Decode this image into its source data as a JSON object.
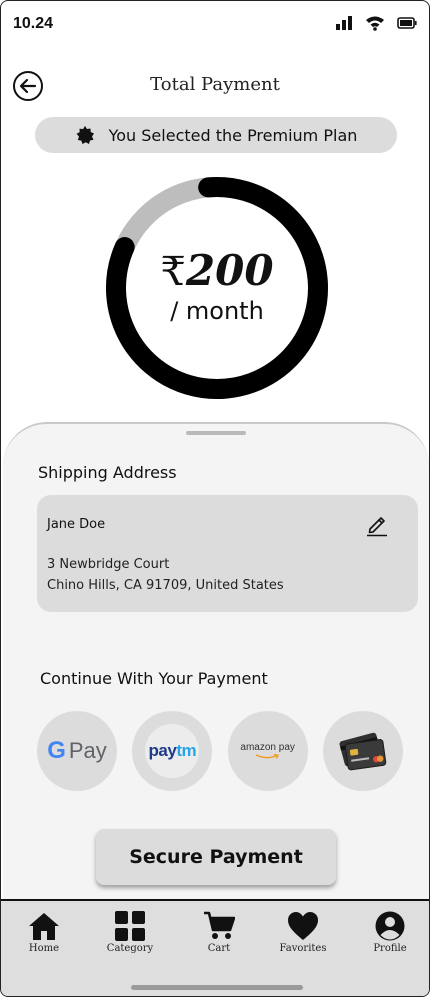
{
  "status_bar": {
    "time": "10.24",
    "icons": [
      "signal-icon",
      "wifi-icon",
      "battery-icon"
    ]
  },
  "header": {
    "title": "Total Payment",
    "back_icon": "arrow-left-icon"
  },
  "plan_banner": {
    "text": "You Selected the Premium Plan",
    "icon": "badge-icon"
  },
  "price": {
    "currency": "₹",
    "amount": "200",
    "period": "/ month",
    "ring_filled_fraction": 0.83
  },
  "shipping": {
    "label": "Shipping Address",
    "name": "Jane Doe",
    "address_line1": "3 Newbridge Court",
    "address_line2": "Chino Hills, CA 91709, United States",
    "edit_icon": "pencil-icon"
  },
  "payment": {
    "label": "Continue With Your Payment",
    "options": [
      {
        "name": "Google Pay",
        "text_g": "G",
        "text_pay": "Pay"
      },
      {
        "name": "Paytm",
        "text_pay": "pay",
        "text_tm": "tm"
      },
      {
        "name": "Amazon Pay",
        "text": "amazon pay"
      },
      {
        "name": "Card",
        "icon": "credit-card-icon"
      }
    ]
  },
  "cta": {
    "label": "Secure Payment"
  },
  "nav": {
    "items": [
      {
        "label": "Home",
        "icon": "home-icon"
      },
      {
        "label": "Category",
        "icon": "grid-icon"
      },
      {
        "label": "Cart",
        "icon": "cart-icon"
      },
      {
        "label": "Favorites",
        "icon": "heart-icon"
      },
      {
        "label": "Profile",
        "icon": "profile-icon"
      }
    ]
  },
  "colors": {
    "ring_filled": "#000000",
    "ring_track": "#bdbdbd",
    "sheet_bg": "#f4f4f4",
    "card_bg": "#dcdcdc"
  }
}
